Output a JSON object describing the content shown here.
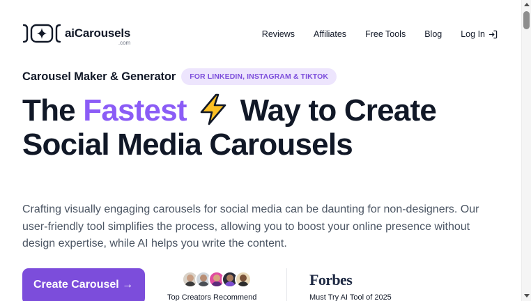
{
  "brand": {
    "name": "aiCarousels",
    "suffix": ".com",
    "logo_icon": "sparkle-carousel-icon"
  },
  "nav": {
    "items": [
      {
        "label": "Reviews"
      },
      {
        "label": "Affiliates"
      },
      {
        "label": "Free Tools"
      },
      {
        "label": "Blog"
      },
      {
        "label": "Log In",
        "icon": "login-arrow-icon"
      }
    ]
  },
  "hero": {
    "eyebrow_title": "Carousel Maker & Generator",
    "eyebrow_badge": "FOR LINKEDIN, INSTAGRAM & TIKTOK",
    "headline_part1": "The",
    "headline_accent": "Fastest",
    "headline_icon": "lightning-bolt-icon",
    "headline_part2": "Way to Create Social Media Carousels",
    "description": "Crafting visually engaging carousels for social media can be daunting for non-designers. Our user-friendly tool simplifies the process, allowing you to boost your online presence without design expertise, while AI helps you write the content.",
    "cta_label": "Create Carousel →"
  },
  "social_proof": {
    "creators_label": "Top Creators Recommend",
    "forbes_logo": "Forbes",
    "forbes_label": "Must Try AI Tool of 2025"
  },
  "colors": {
    "accent": "#8b5cf6",
    "button": "#7c4ddb",
    "badge_bg": "#ede5fd",
    "text": "#111827",
    "muted": "#4b5563"
  }
}
